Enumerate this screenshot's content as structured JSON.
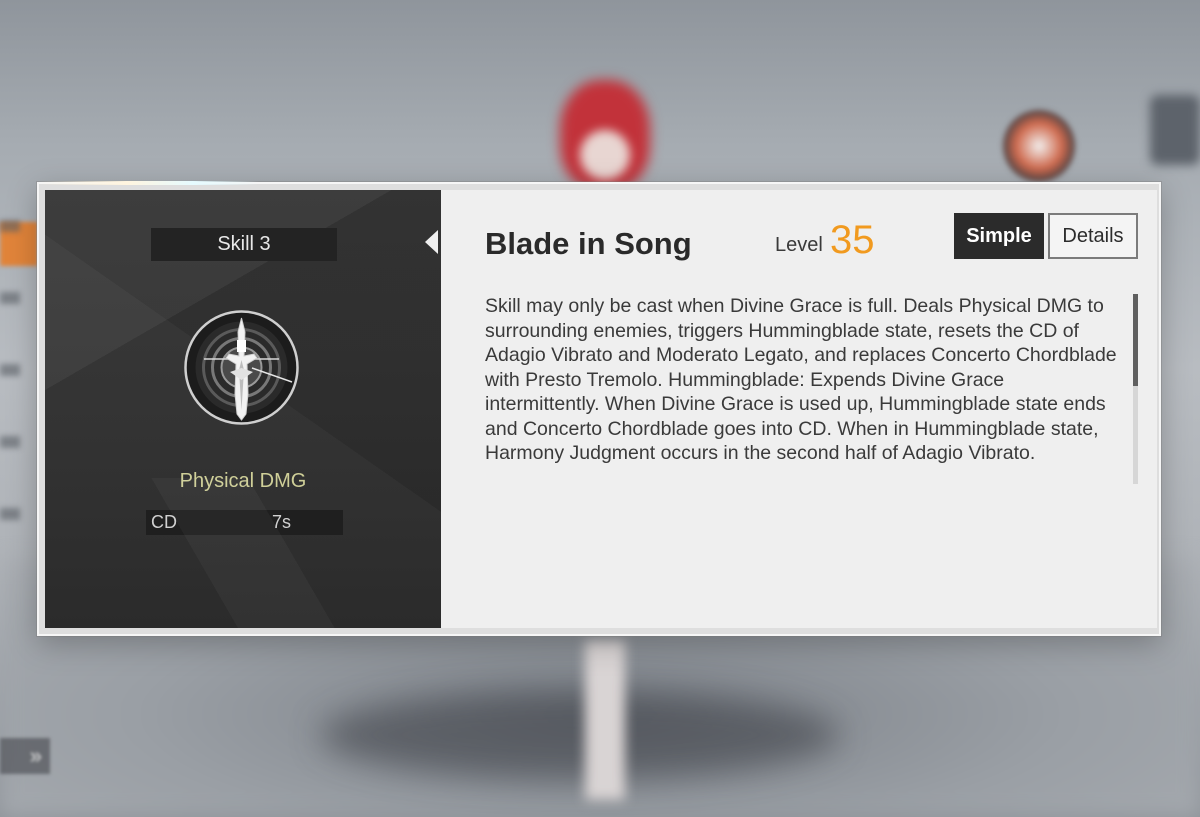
{
  "skill": {
    "slot_label": "Skill 3",
    "name": "Blade in Song",
    "level_label": "Level",
    "level_value": "35",
    "damage_type": "Physical DMG",
    "cd_label": "CD",
    "cd_value": "7s",
    "description": "Skill may only be cast when Divine Grace is full. Deals Physical DMG to surrounding enemies, triggers Hummingblade state, resets the CD of Adagio Vibrato and Moderato Legato, and replaces Concerto Chordblade with Presto Tremolo. Hummingblade: Expends Divine Grace intermittently. When Divine Grace is used up, Hummingblade state ends and Concerto Chordblade goes into CD. When in Hummingblade state, Harmony Judgment occurs in the second half of Adagio Vibrato."
  },
  "tabs": {
    "simple_label": "Simple",
    "details_label": "Details",
    "active": "Simple"
  },
  "icons": {
    "skill_emblem": "sword-emblem-icon",
    "next_arrow": "chevron-right-icon"
  },
  "colors": {
    "level_accent": "#f19a1f",
    "damage_type": "#cfcf98",
    "active_tab_bg": "#2b2b2b"
  },
  "background": {
    "arrow_glyph": "»"
  }
}
